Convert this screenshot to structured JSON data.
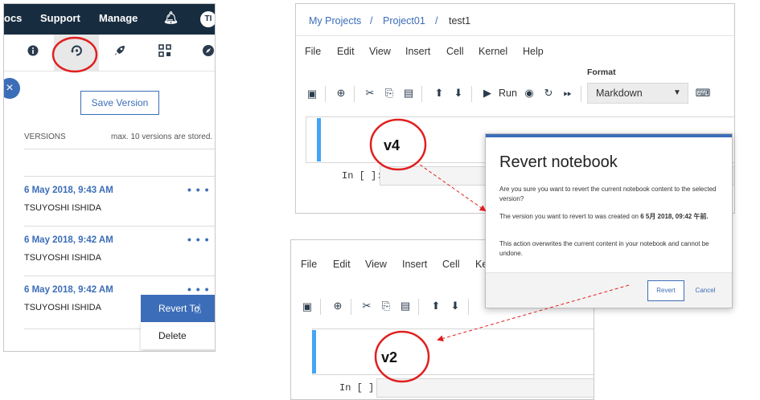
{
  "left_panel": {
    "topbar": {
      "docs": "ocs",
      "support": "Support",
      "manage": "Manage",
      "avatar": "TI"
    },
    "save_version": "Save Version",
    "versions_header": "VERSIONS",
    "max_note": "max. 10 versions are stored.",
    "versions": [
      {
        "date": "6 May 2018, 9:43 AM",
        "user": "TSUYOSHI ISHIDA",
        "more": "• • •"
      },
      {
        "date": "6 May 2018, 9:42 AM",
        "user": "TSUYOSHI ISHIDA",
        "more": "• • •"
      },
      {
        "date": "6 May 2018, 9:42 AM",
        "user": "TSUYOSHI ISHIDA",
        "more": "• • •"
      }
    ],
    "menu": {
      "revert": "Revert To",
      "delete": "Delete"
    },
    "close": "×"
  },
  "top_notebook": {
    "breadcrumb": {
      "projects": "My Projects",
      "sep1": "/",
      "project": "Project01",
      "sep2": "/",
      "notebook": "test1"
    },
    "menus": [
      "File",
      "Edit",
      "View",
      "Insert",
      "Cell",
      "Kernel",
      "Help"
    ],
    "format_label": "Format",
    "format_value": "Markdown",
    "run_label": "Run",
    "prompt": "In [ ]:",
    "version_label": "v4"
  },
  "bottom_notebook": {
    "menus": [
      "File",
      "Edit",
      "View",
      "Insert",
      "Cell",
      "Ke"
    ],
    "prompt": "In [ ]:",
    "version_label": "v2"
  },
  "dialog": {
    "title": "Revert notebook",
    "p1": "Are you sure you want to revert the current notebook content to the selected version?",
    "p2_prefix": "The version you want to revert to was created on ",
    "p2_date": "6 5月 2018, 09:42 午前.",
    "p3": "This action overwrites the current content in your notebook and cannot be undone.",
    "revert": "Revert",
    "cancel": "Cancel"
  },
  "colors": {
    "accent": "#3c6db8",
    "topbar": "#172c3f",
    "annotation": "#e02020",
    "cell_bar": "#42a5f5"
  }
}
